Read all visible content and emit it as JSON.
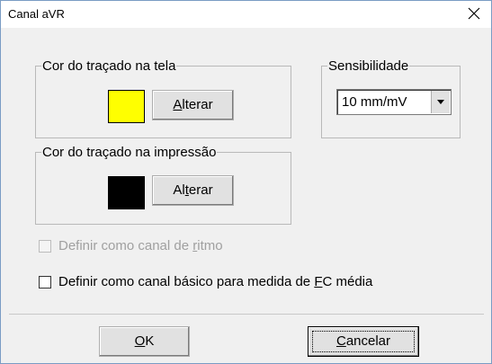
{
  "window": {
    "title": "Canal aVR",
    "close_glyph": "×"
  },
  "screen_color": {
    "legend": "Cor do traçado na tela",
    "swatch_color": "#ffff00",
    "button_pre": "",
    "button_mnemonic": "A",
    "button_post": "lterar"
  },
  "print_color": {
    "legend": "Cor do traçado na impressão",
    "swatch_color": "#000000",
    "button_pre": "Al",
    "button_mnemonic": "t",
    "button_post": "erar"
  },
  "sensitivity": {
    "legend": "Sensibilidade",
    "selected": "10 mm/mV"
  },
  "checkboxes": {
    "rhythm": {
      "pre": "Definir como canal de ",
      "mnemonic": "r",
      "post": "itmo",
      "checked": false,
      "disabled": true
    },
    "basic": {
      "pre": "Definir como canal básico para medida de ",
      "mnemonic": "F",
      "post": "C média",
      "checked": false,
      "disabled": false
    }
  },
  "buttons": {
    "ok": {
      "pre": "",
      "mnemonic": "O",
      "post": "K"
    },
    "cancel": {
      "pre": "",
      "mnemonic": "C",
      "post": "ancelar"
    }
  },
  "icons": {
    "close": "close-icon",
    "dropdown": "chevron-down-icon"
  }
}
